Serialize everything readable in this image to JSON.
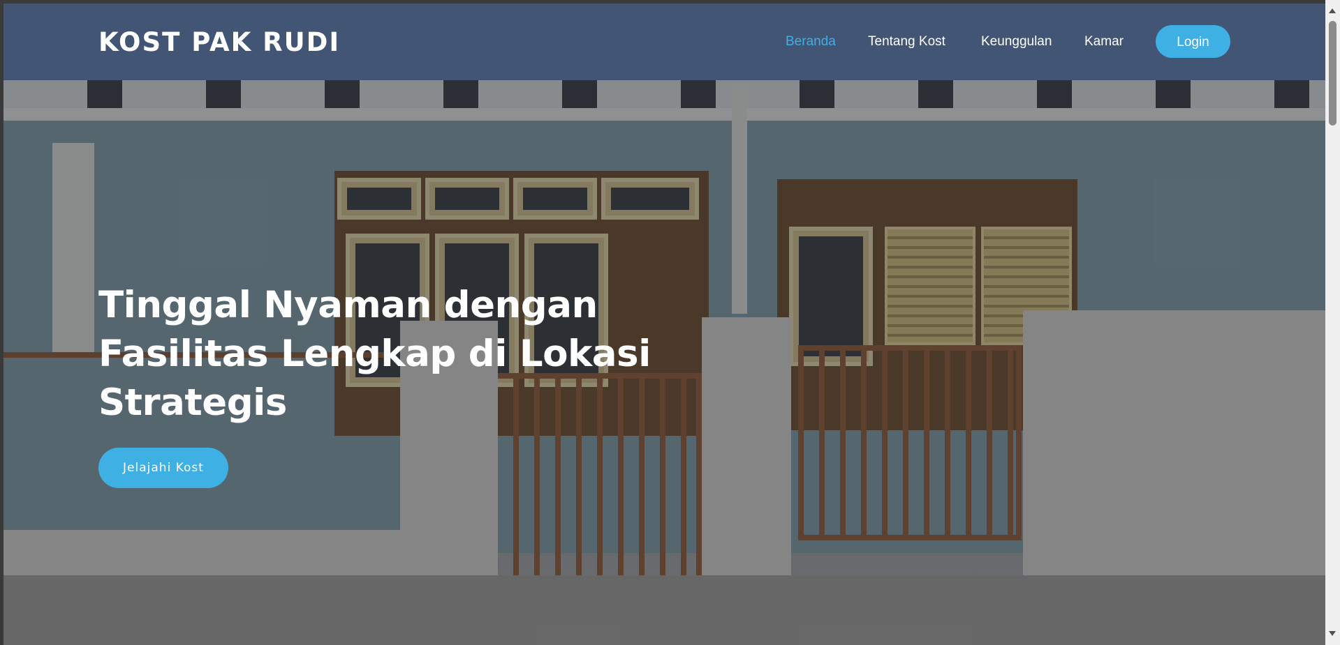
{
  "navbar": {
    "brand": "KOST PAK RUDI",
    "links": [
      {
        "label": "Beranda",
        "active": true
      },
      {
        "label": "Tentang Kost",
        "active": false
      },
      {
        "label": "Keunggulan",
        "active": false
      },
      {
        "label": "Kamar",
        "active": false
      }
    ],
    "login_label": "Login"
  },
  "hero": {
    "title": "Tinggal Nyaman dengan Fasilitas Lengkap di Lokasi Strategis",
    "cta_label": "Jelajahi Kost",
    "background_image": "house-facade-photo"
  },
  "colors": {
    "navbar_bg": "#435574",
    "accent": "#3fb0e3",
    "text": "#ffffff"
  }
}
